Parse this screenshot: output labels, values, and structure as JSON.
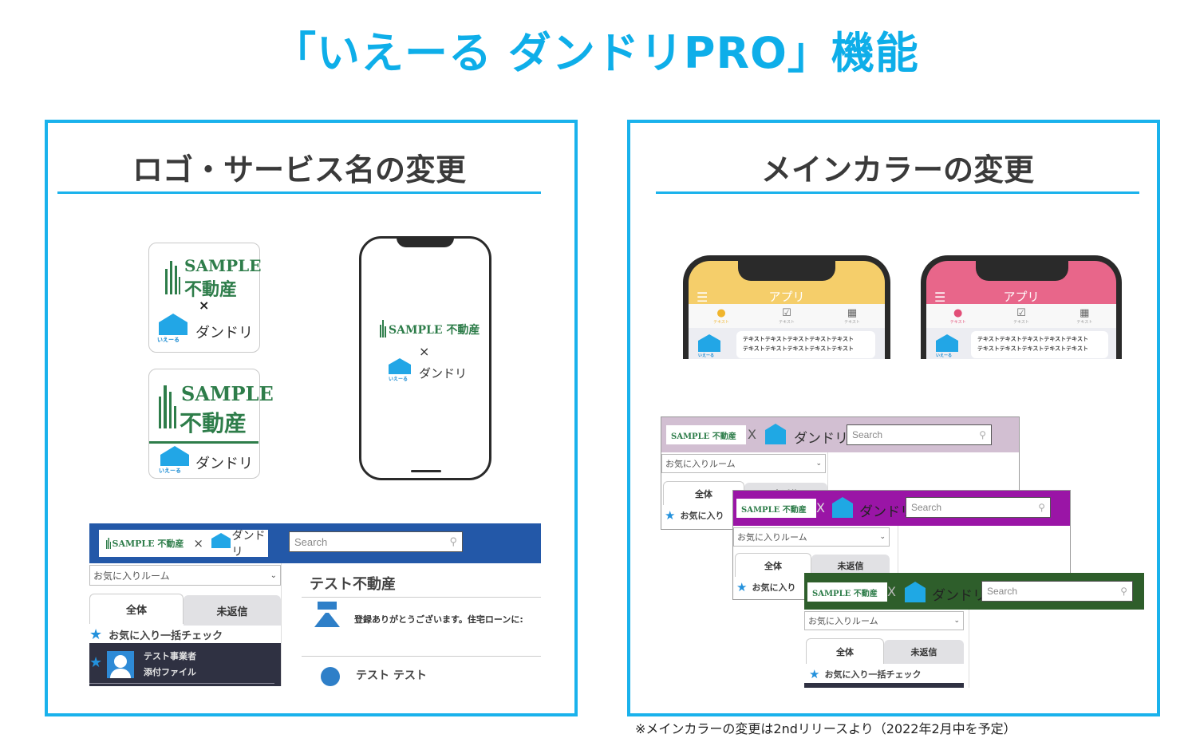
{
  "title": "「いえーる ダンドリPRO」機能",
  "colors": {
    "accent": "#0eaee9",
    "panel_border": "#1ab2ec",
    "brand_green": "#2e7d4a",
    "ieru_blue": "#22a6e6",
    "theme_blue": "#2358a8",
    "theme_yellow": "#f5ce6a",
    "theme_pink": "#e8668a",
    "theme_lavender": "#d2bfd2",
    "theme_purple": "#9a15a6",
    "theme_green": "#2e5e2b"
  },
  "left_panel": {
    "heading": "ロゴ・サービス名の変更",
    "logo_card_1": {
      "brand_en": "SAMPLE",
      "brand_jp": "不動産",
      "times": "×",
      "ieru": "いえーる",
      "service": "ダンドリ"
    },
    "logo_card_2": {
      "brand_en": "SAMPLE",
      "brand_jp": "不動産",
      "ieru": "いえーる",
      "service": "ダンドリ"
    },
    "phone_splash": {
      "brand": "SAMPLE 不動産",
      "times": "×",
      "ieru": "いえーる",
      "service": "ダンドリ"
    },
    "web_mock": {
      "header_brand": "SAMPLE 不動産",
      "header_times": "×",
      "header_ieru": "いえーる",
      "header_service": "ダンドリ",
      "search_placeholder": "Search",
      "room_select": "お気に入りルーム",
      "tab_all": "全体",
      "tab_unreplied": "未返信",
      "favorite_check": "お気に入り一括チェック",
      "room_item": {
        "name": "テスト事業者",
        "sub": "添付ファイル"
      },
      "content_title": "テスト不動産",
      "messages": [
        {
          "name": "テスト テスト",
          "text": "登録ありがとうございます。住宅ローンに:"
        },
        {
          "name": "テスト テスト",
          "text": ""
        }
      ]
    }
  },
  "right_panel": {
    "heading": "メインカラーの変更",
    "phones": [
      {
        "theme": "yellow",
        "app_title": "アプリ",
        "tabs": [
          "テキスト",
          "テキスト",
          "テキスト"
        ],
        "ieru": "いえーる",
        "message_lines": [
          "テキストテキストテキストテキストテキスト",
          "テキストテキストテキストテキストテキスト"
        ]
      },
      {
        "theme": "pink",
        "app_title": "アプリ",
        "tabs": [
          "テキスト",
          "テキスト",
          "テキスト"
        ],
        "ieru": "いえーる",
        "message_lines": [
          "テキストテキストテキストテキストテキスト",
          "テキストテキストテキストテキストテキスト"
        ]
      }
    ],
    "web_mocks": [
      {
        "theme": "lavender",
        "brand": "SAMPLE 不動産",
        "times": "X",
        "ieru": "いえーる",
        "service": "ダンドリ",
        "search_placeholder": "Search",
        "room_select": "お気に入りルーム",
        "tab_all": "全体",
        "tab_unreplied": "未返信",
        "favorite_check": "お気に入り"
      },
      {
        "theme": "purple",
        "brand": "SAMPLE 不動産",
        "times": "X",
        "ieru": "いえーる",
        "service": "ダンドリ",
        "search_placeholder": "Search",
        "room_select": "お気に入りルーム",
        "tab_all": "全体",
        "tab_unreplied": "未返信",
        "favorite_check": "お気に入り"
      },
      {
        "theme": "green",
        "brand": "SAMPLE 不動産",
        "times": "X",
        "ieru": "いえーる",
        "service": "ダンドリ",
        "search_placeholder": "Search",
        "room_select": "お気に入りルーム",
        "tab_all": "全体",
        "tab_unreplied": "未返信",
        "favorite_check": "お気に入り一括チェック"
      }
    ]
  },
  "footnote": "※メインカラーの変更は2ndリリースより（2022年2月中を予定）"
}
